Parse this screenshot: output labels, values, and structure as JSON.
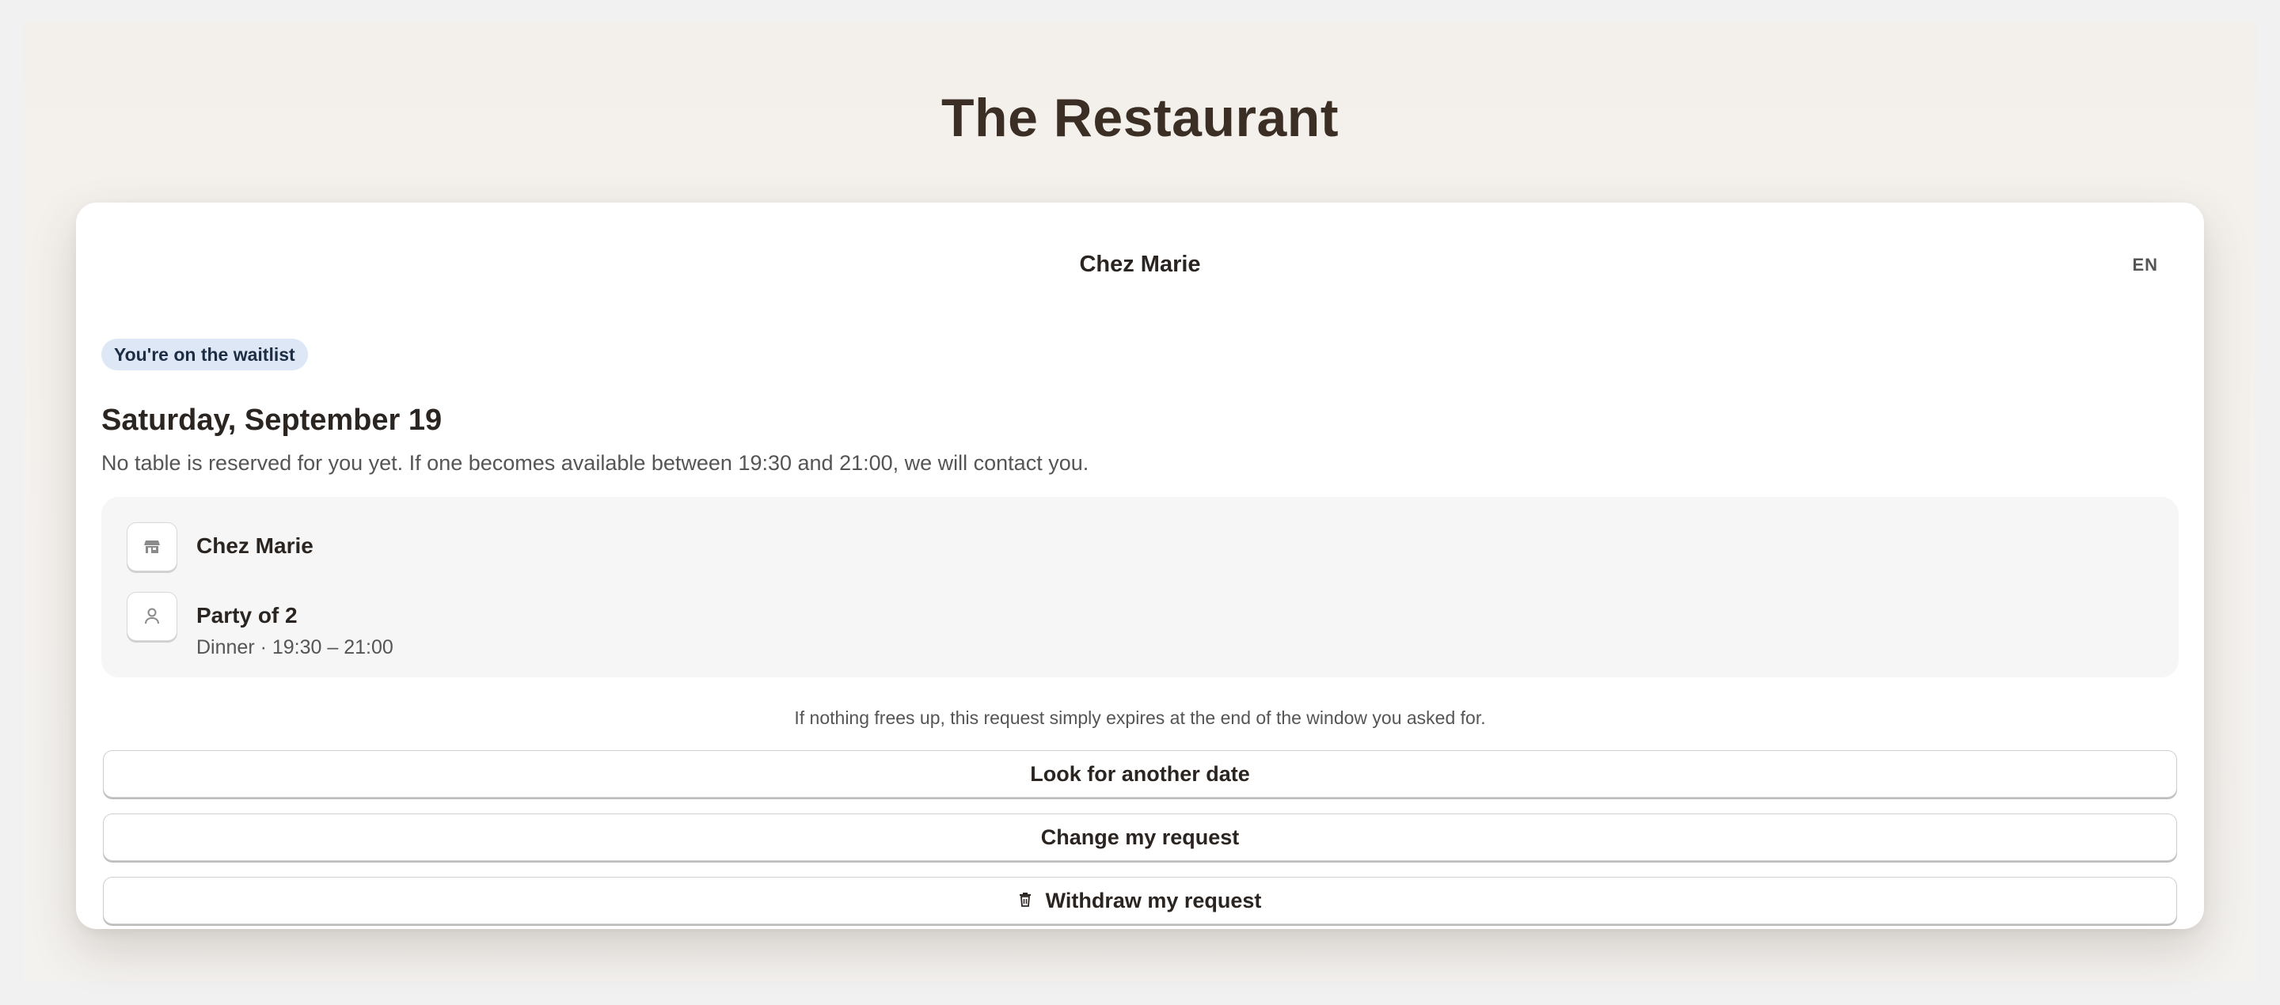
{
  "site": {
    "title": "The Restaurant"
  },
  "card": {
    "title": "Chez Marie",
    "language": "EN",
    "status_badge": "You're on the waitlist",
    "date_heading": "Saturday, September 19",
    "date_subtitle": "No table is reserved for you yet. If one becomes available between 19:30 and 21:00, we will contact you.",
    "details": {
      "restaurant": {
        "label": "Chez Marie",
        "icon": "store-icon"
      },
      "party": {
        "label": "Party of 2",
        "sub": "Dinner · 19:30 – 21:00",
        "icon": "person-icon"
      }
    },
    "note": "If nothing frees up, this request simply expires at the end of the window you asked for.",
    "actions": {
      "another_date": "Look for another date",
      "change": "Change my request",
      "withdraw": "Withdraw my request",
      "withdraw_icon": "trash-icon"
    }
  },
  "colors": {
    "badge_bg": "#dde7f6",
    "badge_text": "#1d2d44",
    "title": "#3a2e25"
  }
}
